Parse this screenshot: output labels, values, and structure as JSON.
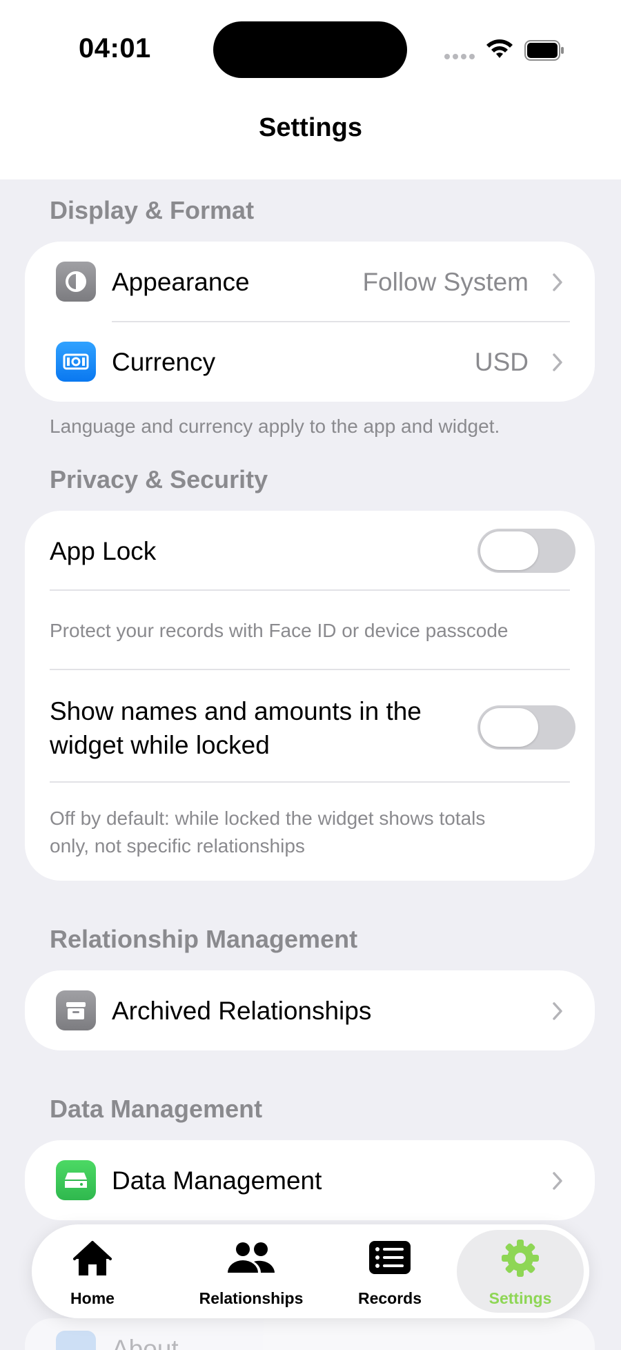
{
  "status_bar": {
    "time": "04:01"
  },
  "nav": {
    "title": "Settings"
  },
  "display_format": {
    "header": "Display & Format",
    "appearance": {
      "label": "Appearance",
      "value": "Follow System"
    },
    "currency": {
      "label": "Currency",
      "value": "USD"
    },
    "footer": "Language and currency apply to the app and widget."
  },
  "privacy_security": {
    "header": "Privacy & Security",
    "app_lock": {
      "label": "App Lock",
      "on": false
    },
    "app_lock_desc": "Protect your records with Face ID or device passcode",
    "widget_locked": {
      "label_line1": "Show names and amounts in the",
      "label_line2": "widget while locked",
      "on": false
    },
    "widget_desc_line1": "Off by default: while locked the widget shows totals",
    "widget_desc_line2": "only, not specific relationships"
  },
  "relationship_management": {
    "header": "Relationship Management",
    "archived": {
      "label": "Archived Relationships"
    }
  },
  "data_management": {
    "header": "Data Management",
    "item": {
      "label": "Data Management"
    }
  },
  "peek": {
    "label": "About"
  },
  "tabbar": {
    "tabs": [
      {
        "label": "Home",
        "icon": "house-icon",
        "active": false
      },
      {
        "label": "Relationships",
        "icon": "people-icon",
        "active": false
      },
      {
        "label": "Records",
        "icon": "list-icon",
        "active": false
      },
      {
        "label": "Settings",
        "icon": "gear-icon",
        "active": true
      }
    ]
  },
  "colors": {
    "accent": "#8ed655",
    "currency_icon": "#1a8cff",
    "data_icon": "#34c759",
    "gray_icon": "#8e8e93",
    "background": "#efeff4"
  }
}
